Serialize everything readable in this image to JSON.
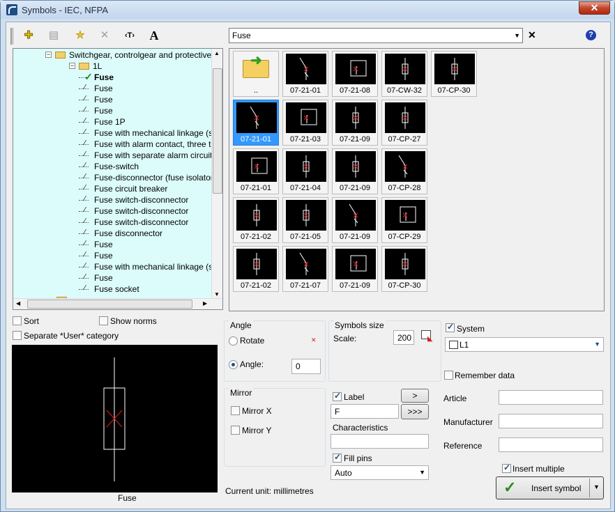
{
  "window": {
    "title": "Symbols - IEC, NFPA",
    "close_glyph": "✕"
  },
  "toolbar": {
    "icons": [
      "add-icon",
      "list-icon",
      "star-icon",
      "delete-icon",
      "text-tag-icon",
      "text-style-icon"
    ],
    "glyphs": {
      "add": "✚",
      "list": "▤",
      "star": "★",
      "delete": "✕",
      "texttag": "‹T›",
      "textstyle": "A"
    }
  },
  "search": {
    "value": "Fuse",
    "clear_glyph": "✕",
    "help_glyph": "?"
  },
  "tree": {
    "items": [
      {
        "label": "Switchgear, controlgear and protective de",
        "level": 0,
        "kind": "folder"
      },
      {
        "label": "1L",
        "level": 1,
        "kind": "folder"
      },
      {
        "label": "Fuse",
        "level": 2,
        "kind": "current"
      },
      {
        "label": "Fuse",
        "level": 2,
        "kind": "symbol"
      },
      {
        "label": "Fuse",
        "level": 2,
        "kind": "symbol"
      },
      {
        "label": "Fuse",
        "level": 2,
        "kind": "symbol"
      },
      {
        "label": "Fuse 1P",
        "level": 2,
        "kind": "symbol"
      },
      {
        "label": "Fuse with mechanical linkage (strike",
        "level": 2,
        "kind": "symbol"
      },
      {
        "label": "Fuse with alarm contact, three term",
        "level": 2,
        "kind": "symbol"
      },
      {
        "label": "Fuse with separate alarm circuit",
        "level": 2,
        "kind": "symbol"
      },
      {
        "label": "Fuse-switch",
        "level": 2,
        "kind": "symbol"
      },
      {
        "label": "Fuse-disconnector (fuse isolator)",
        "level": 2,
        "kind": "symbol"
      },
      {
        "label": "Fuse circuit breaker",
        "level": 2,
        "kind": "symbol"
      },
      {
        "label": "Fuse switch-disconnector",
        "level": 2,
        "kind": "symbol"
      },
      {
        "label": "Fuse switch-disconnector",
        "level": 2,
        "kind": "symbol"
      },
      {
        "label": "Fuse switch-disconnector",
        "level": 2,
        "kind": "symbol"
      },
      {
        "label": "Fuse disconnector",
        "level": 2,
        "kind": "symbol"
      },
      {
        "label": "Fuse",
        "level": 2,
        "kind": "symbol"
      },
      {
        "label": "Fuse",
        "level": 2,
        "kind": "symbol"
      },
      {
        "label": "Fuse with mechanical linkage (strike",
        "level": 2,
        "kind": "symbol"
      },
      {
        "label": "Fuse",
        "level": 2,
        "kind": "symbol"
      },
      {
        "label": "Fuse socket",
        "level": 2,
        "kind": "symbol"
      }
    ]
  },
  "symbol_grid": {
    "rows": [
      [
        {
          "label": "..",
          "kind": "folder-up"
        },
        {
          "label": "07-21-01"
        },
        {
          "label": "07-21-08"
        },
        {
          "label": "07-CW-32"
        },
        {
          "label": "07-CP-30"
        }
      ],
      [
        {
          "label": "07-21-01",
          "selected": true
        },
        {
          "label": "07-21-03"
        },
        {
          "label": "07-21-09"
        },
        {
          "label": "07-CP-27"
        }
      ],
      [
        {
          "label": "07-21-01"
        },
        {
          "label": "07-21-04"
        },
        {
          "label": "07-21-09"
        },
        {
          "label": "07-CP-28"
        }
      ],
      [
        {
          "label": "07-21-02"
        },
        {
          "label": "07-21-05"
        },
        {
          "label": "07-21-09"
        },
        {
          "label": "07-CP-29"
        }
      ],
      [
        {
          "label": "07-21-02"
        },
        {
          "label": "07-21-07"
        },
        {
          "label": "07-21-09"
        },
        {
          "label": "07-CP-30"
        }
      ]
    ]
  },
  "options": {
    "sort": "Sort",
    "show_norms": "Show norms",
    "separate_user": "Separate *User* category"
  },
  "preview": {
    "caption": "Fuse"
  },
  "angle": {
    "title": "Angle",
    "rotate": "Rotate",
    "angle_label": "Angle:",
    "angle_value": "0"
  },
  "symbols_size": {
    "title": "Symbols size",
    "scale_label": "Scale:",
    "scale_value": "200"
  },
  "mirror": {
    "title": "Mirror",
    "mirror_x": "Mirror X",
    "mirror_y": "Mirror Y"
  },
  "label": {
    "label": "Label",
    "value": "F",
    "arrow_single": ">",
    "arrow_triple": ">>>"
  },
  "characteristics": {
    "label": "Characteristics",
    "value": ""
  },
  "fill_pins": {
    "label": "Fill pins",
    "value": "Auto"
  },
  "system": {
    "label": "System",
    "value": "L1"
  },
  "remember_data": "Remember data",
  "article": "Article",
  "manufacturer": "Manufacturer",
  "reference": "Reference",
  "insert_multiple": "Insert multiple",
  "insert_button": "Insert symbol",
  "status": "Current unit: millimetres",
  "colors": {
    "tree_bg": "#dcfcfc",
    "selection": "#3399ff",
    "red_mark": "#e01c1c"
  }
}
